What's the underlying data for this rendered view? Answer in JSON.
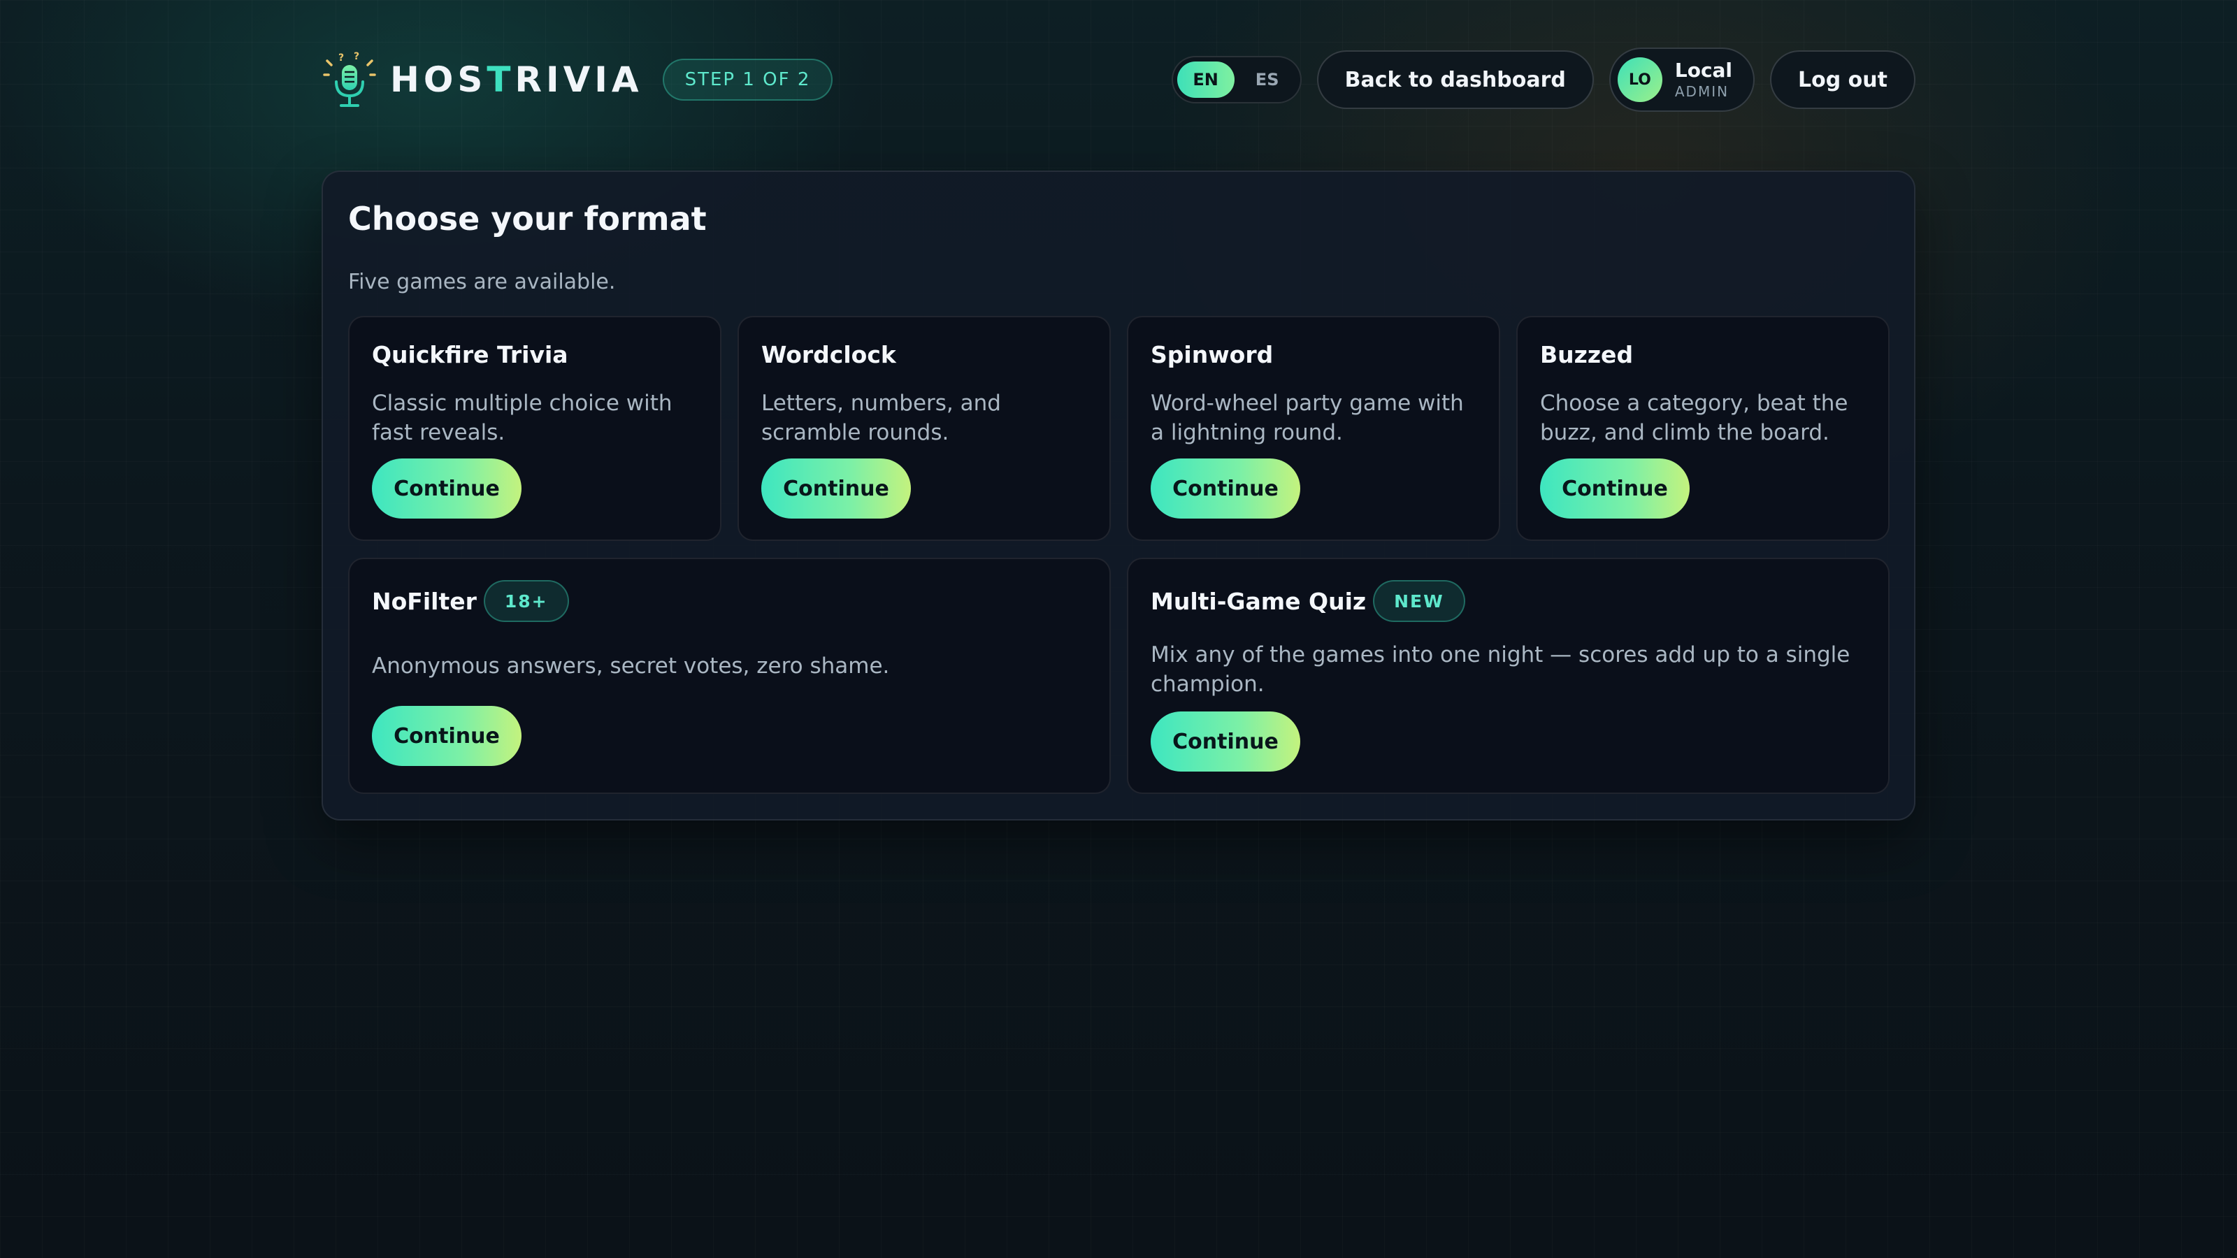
{
  "header": {
    "brand_prefix": "HOS",
    "brand_accent": "T",
    "brand_suffix": "RIVIA",
    "step_badge": "STEP 1 OF 2",
    "lang": {
      "options": [
        "EN",
        "ES"
      ],
      "selected": "EN"
    },
    "back_label": "Back to dashboard",
    "user": {
      "initials": "LO",
      "name": "Local",
      "role": "ADMIN"
    },
    "logout_label": "Log out"
  },
  "main": {
    "title": "Choose your format",
    "subtitle": "Five games are available.",
    "games": [
      {
        "title": "Quickfire Trivia",
        "desc": "Classic multiple choice with fast reveals.",
        "button": "Continue"
      },
      {
        "title": "Wordclock",
        "desc": "Letters, numbers, and scramble rounds.",
        "button": "Continue"
      },
      {
        "title": "Spinword",
        "desc": "Word-wheel party game with a lightning round.",
        "button": "Continue"
      },
      {
        "title": "Buzzed",
        "desc": "Choose a category, beat the buzz, and climb the board.",
        "button": "Continue"
      },
      {
        "title": "NoFilter",
        "tag": "18+",
        "desc": "Anonymous answers, secret votes, zero shame.",
        "button": "Continue"
      },
      {
        "title": "Multi-Game Quiz",
        "tag": "NEW",
        "desc": "Mix any of the games into one night — scores add up to a single champion.",
        "button": "Continue"
      }
    ]
  },
  "colors": {
    "accent": "#3ee0c0",
    "button_gradient_start": "#3ee6c0",
    "button_gradient_end": "#c4f27e",
    "panel_bg": "#111a27",
    "card_bg": "#0a0f1a"
  },
  "icons": {
    "logo": "microphone-icon"
  }
}
